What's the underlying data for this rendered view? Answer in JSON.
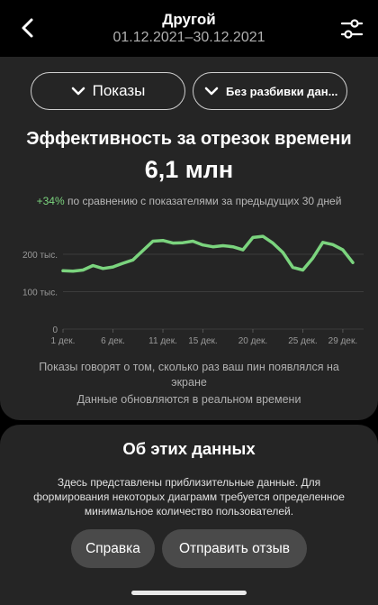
{
  "header": {
    "title": "Другой",
    "date_range": "01.12.2021–30.12.2021"
  },
  "filters": {
    "metric_label": "Показы",
    "breakdown_label": "Без разбивки дан..."
  },
  "performance": {
    "title": "Эффективность за отрезок времени",
    "total": "6,1 млн",
    "change": "+34%",
    "change_text": "по сравнению с показателями за предыдущих 30 дней",
    "note": "Показы говорят о том, сколько раз ваш пин появлялся на экране",
    "realtime_note": "Данные обновляются в реальном времени"
  },
  "chart_data": {
    "type": "line",
    "x": [
      1,
      2,
      3,
      4,
      5,
      6,
      7,
      8,
      9,
      10,
      11,
      12,
      13,
      14,
      15,
      16,
      17,
      18,
      19,
      20,
      21,
      22,
      23,
      24,
      25,
      26,
      27,
      28,
      29,
      30
    ],
    "series": [
      {
        "values": [
          156,
          155,
          158,
          170,
          162,
          166,
          176,
          185,
          210,
          235,
          237,
          230,
          231,
          235,
          225,
          220,
          223,
          220,
          212,
          245,
          248,
          230,
          205,
          165,
          158,
          190,
          232,
          226,
          212,
          178
        ]
      }
    ],
    "x_tick_labels": [
      "1 дек.",
      "6 дек.",
      "11 дек.",
      "15 дек.",
      "20 дек.",
      "25 дек.",
      "29 дек."
    ],
    "x_tick_positions": [
      1,
      6,
      11,
      15,
      20,
      25,
      29
    ],
    "y_tick_labels": [
      "0",
      "100 тыс.",
      "200 тыс."
    ],
    "y_tick_values": [
      0,
      100,
      200
    ],
    "ylim": [
      0,
      270
    ],
    "grid": true,
    "color": "#7bd47e"
  },
  "about": {
    "title": "Об этих данных",
    "text": "Здесь представлены приблизительные данные. Для формирования некоторых диаграмм требуется определенное минимальное количество пользователей.",
    "help_button": "Справка",
    "feedback_button": "Отправить отзыв"
  },
  "icons": {
    "back": "chevron-left-icon",
    "filter": "sliders-icon",
    "dropdown": "chevron-down-icon"
  }
}
